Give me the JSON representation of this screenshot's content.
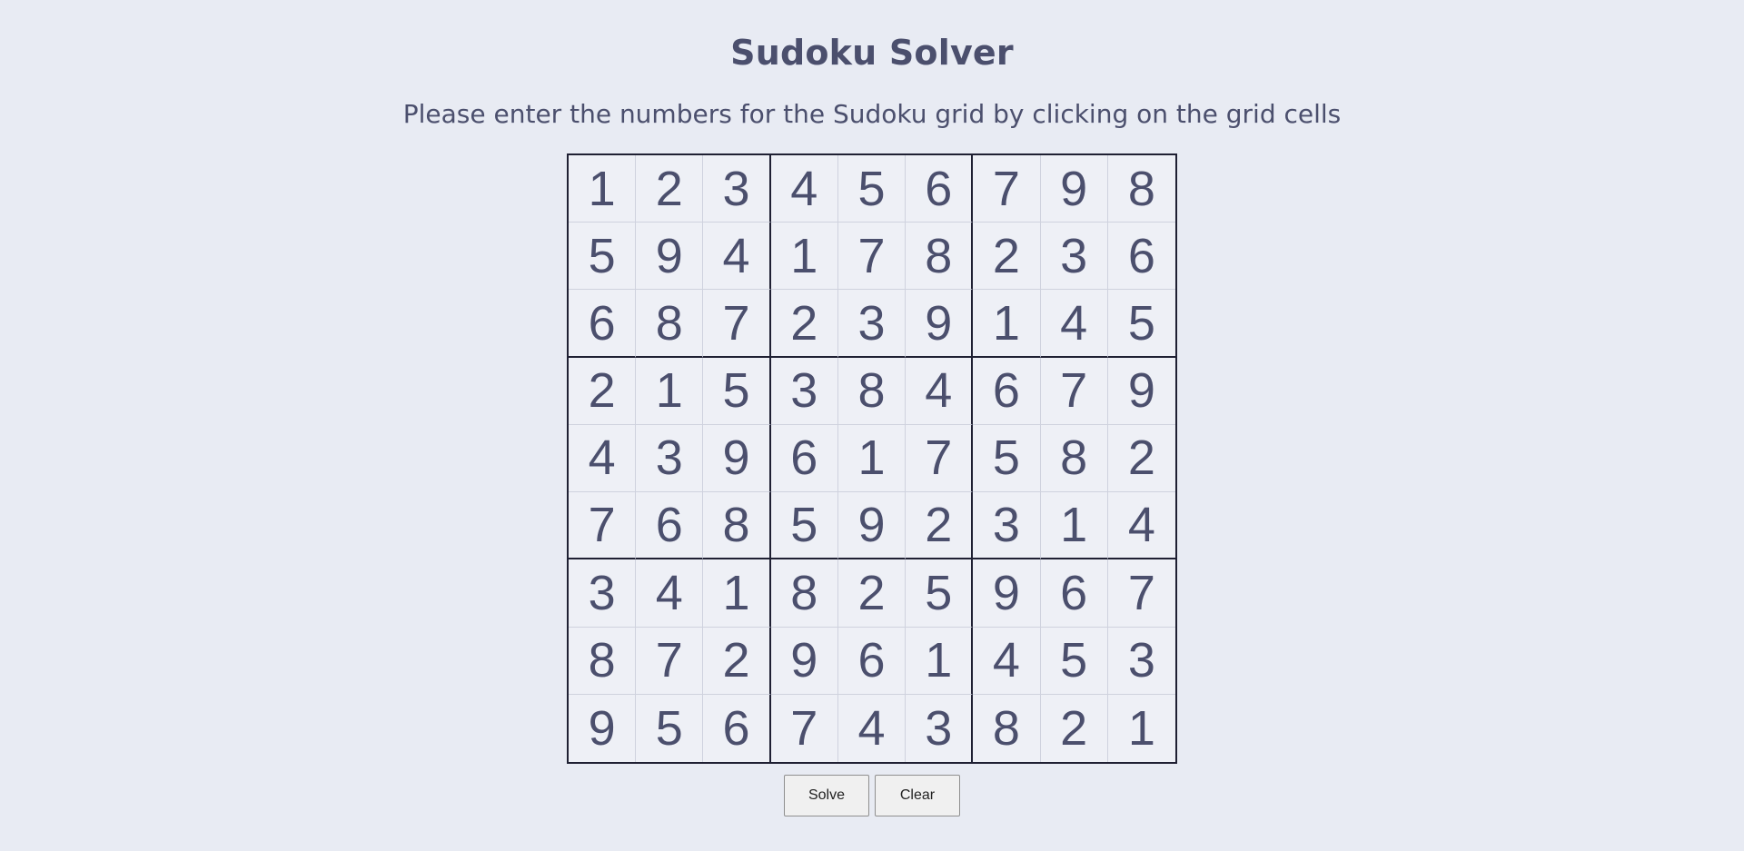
{
  "header": {
    "title": "Sudoku Solver",
    "subtitle": "Please enter the numbers for the Sudoku grid by clicking on the grid cells"
  },
  "grid": {
    "rows": [
      [
        "1",
        "2",
        "3",
        "4",
        "5",
        "6",
        "7",
        "9",
        "8"
      ],
      [
        "5",
        "9",
        "4",
        "1",
        "7",
        "8",
        "2",
        "3",
        "6"
      ],
      [
        "6",
        "8",
        "7",
        "2",
        "3",
        "9",
        "1",
        "4",
        "5"
      ],
      [
        "2",
        "1",
        "5",
        "3",
        "8",
        "4",
        "6",
        "7",
        "9"
      ],
      [
        "4",
        "3",
        "9",
        "6",
        "1",
        "7",
        "5",
        "8",
        "2"
      ],
      [
        "7",
        "6",
        "8",
        "5",
        "9",
        "2",
        "3",
        "1",
        "4"
      ],
      [
        "3",
        "4",
        "1",
        "8",
        "2",
        "5",
        "9",
        "6",
        "7"
      ],
      [
        "8",
        "7",
        "2",
        "9",
        "6",
        "1",
        "4",
        "5",
        "3"
      ],
      [
        "9",
        "5",
        "6",
        "7",
        "4",
        "3",
        "8",
        "2",
        "1"
      ]
    ]
  },
  "controls": {
    "solve_label": "Solve",
    "clear_label": "Clear"
  },
  "colors": {
    "background": "#e8ebf3",
    "text": "#4b4f6d",
    "box_border": "#1f2033",
    "cell_border": "#cfd2de"
  }
}
